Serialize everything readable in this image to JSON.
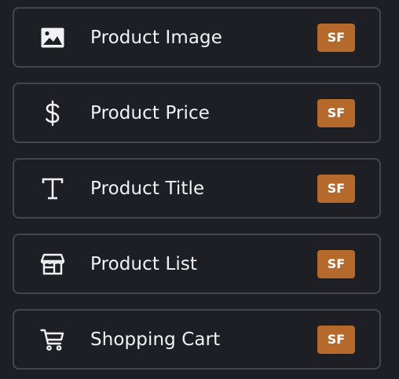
{
  "theme": {
    "background": "#1e1f24",
    "border": "#45464d",
    "text": "#f2f2f4",
    "badge": "#b5692a"
  },
  "items": [
    {
      "label": "Product Image",
      "icon": "image-icon",
      "badge": "SF"
    },
    {
      "label": "Product Price",
      "icon": "dollar-icon",
      "badge": "SF"
    },
    {
      "label": "Product Title",
      "icon": "text-icon",
      "badge": "SF"
    },
    {
      "label": "Product List",
      "icon": "store-icon",
      "badge": "SF"
    },
    {
      "label": "Shopping Cart",
      "icon": "cart-icon",
      "badge": "SF"
    }
  ]
}
